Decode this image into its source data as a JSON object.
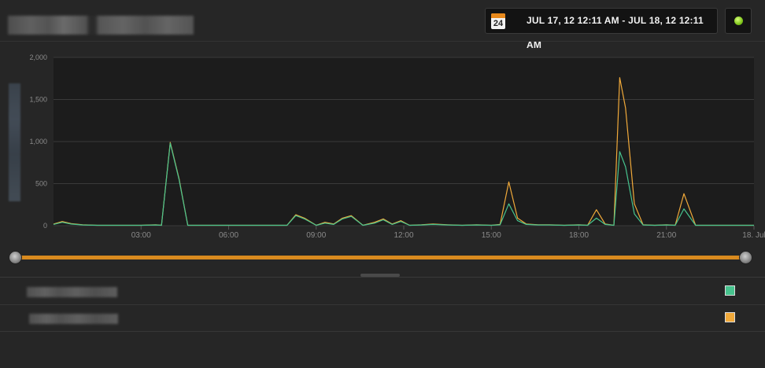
{
  "header": {
    "date_range": "JUL 17, 12 12:11 AM - JUL 18, 12 12:11 AM",
    "calendar_icon": "calendar-icon",
    "calendar_day": "24",
    "status_icon": "status-dot-icon",
    "status_color": "#7fc51b"
  },
  "chart_data": {
    "type": "line",
    "y_ticks": [
      "2,000",
      "1,500",
      "1,000",
      "500",
      "0"
    ],
    "ylim": [
      0,
      2000
    ],
    "x_ticks": [
      "03:00",
      "06:00",
      "09:00",
      "12:00",
      "15:00",
      "18:00",
      "21:00",
      "18. Jul"
    ],
    "x_tick_hours": [
      3,
      6,
      9,
      12,
      15,
      18,
      21,
      24
    ],
    "xlim_hours": [
      0,
      24
    ],
    "grid": true,
    "legend": "below",
    "series": [
      {
        "color": "#f0a93a",
        "hours": [
          0,
          0.3,
          0.6,
          1,
          1.5,
          2,
          2.5,
          3,
          3.5,
          3.7,
          4,
          4.3,
          4.6,
          5,
          5.5,
          6,
          6.5,
          7,
          7.5,
          8,
          8.3,
          8.6,
          9,
          9.3,
          9.6,
          9.9,
          10.2,
          10.6,
          11,
          11.3,
          11.6,
          11.9,
          12.2,
          12.6,
          13,
          13.5,
          14,
          14.5,
          15,
          15.3,
          15.6,
          15.9,
          16.2,
          16.6,
          17,
          17.5,
          18,
          18.3,
          18.6,
          18.9,
          19.2,
          19.4,
          19.6,
          19.9,
          20.2,
          20.6,
          21,
          21.3,
          21.6,
          22,
          22.5,
          23,
          24
        ],
        "values": [
          20,
          50,
          25,
          10,
          5,
          5,
          5,
          5,
          10,
          5,
          990,
          560,
          5,
          5,
          5,
          5,
          5,
          5,
          5,
          5,
          130,
          90,
          5,
          40,
          20,
          90,
          120,
          5,
          40,
          80,
          20,
          60,
          5,
          10,
          20,
          10,
          5,
          10,
          5,
          15,
          520,
          90,
          20,
          10,
          10,
          5,
          10,
          5,
          190,
          20,
          5,
          1760,
          1400,
          260,
          10,
          5,
          10,
          5,
          380,
          5,
          5,
          5,
          5
        ]
      },
      {
        "color": "#47c38e",
        "hours": [
          0,
          0.3,
          0.6,
          1,
          1.5,
          2,
          2.5,
          3,
          3.5,
          3.7,
          4,
          4.3,
          4.6,
          5,
          5.5,
          6,
          6.5,
          7,
          7.5,
          8,
          8.3,
          8.6,
          9,
          9.3,
          9.6,
          9.9,
          10.2,
          10.6,
          11,
          11.3,
          11.6,
          11.9,
          12.2,
          12.6,
          13,
          13.5,
          14,
          14.5,
          15,
          15.3,
          15.6,
          15.9,
          16.2,
          16.6,
          17,
          17.5,
          18,
          18.3,
          18.6,
          18.9,
          19.2,
          19.4,
          19.6,
          19.9,
          20.2,
          20.6,
          21,
          21.3,
          21.6,
          22,
          22.5,
          23,
          24
        ],
        "values": [
          15,
          40,
          20,
          8,
          5,
          5,
          5,
          5,
          8,
          5,
          980,
          550,
          5,
          5,
          5,
          5,
          5,
          5,
          5,
          5,
          120,
          80,
          5,
          30,
          15,
          80,
          110,
          5,
          30,
          70,
          15,
          50,
          5,
          8,
          15,
          8,
          5,
          8,
          5,
          10,
          260,
          60,
          15,
          8,
          8,
          5,
          8,
          5,
          90,
          15,
          5,
          880,
          700,
          140,
          8,
          5,
          8,
          5,
          200,
          5,
          5,
          5,
          5
        ]
      }
    ]
  },
  "legend": {
    "row1_swatch_color": "#47c38e",
    "row2_swatch_color": "#f0a93a"
  }
}
